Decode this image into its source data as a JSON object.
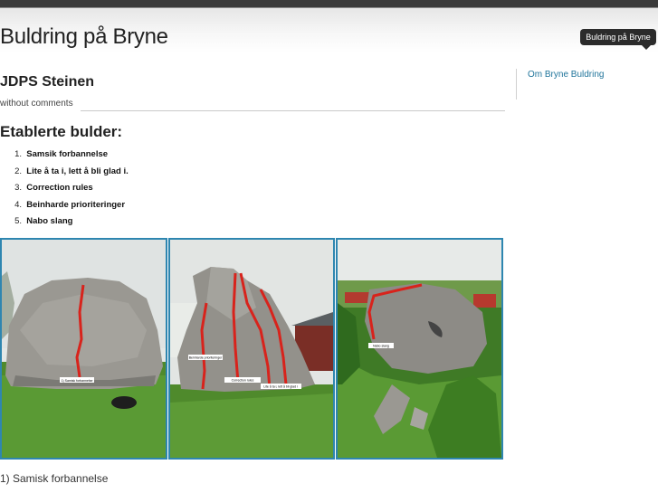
{
  "header": {
    "site_title": "Buldring på Bryne",
    "badge_label": "Buldring på Bryne"
  },
  "post": {
    "title": "JDPS Steinen",
    "meta": "without comments",
    "section_heading": "Etablerte bulder:",
    "bulder": [
      {
        "num": "1.",
        "label": "Samsik forbannelse"
      },
      {
        "num": "2.",
        "label": "Lite å ta i, lett å bli glad i."
      },
      {
        "num": "3.",
        "label": "Correction rules"
      },
      {
        "num": "4.",
        "label": "Beinharde prioriteringer"
      },
      {
        "num": "5.",
        "label": "Nabo slang"
      }
    ],
    "photos": [
      {
        "route_labels": [
          "1) Samisk forbannelse"
        ]
      },
      {
        "route_labels": [
          "Beinharde prioriteringer",
          "Correction rules",
          "Lite å ta i, lett å bli glad i"
        ]
      },
      {
        "route_labels": [
          "Nabo slang"
        ]
      }
    ],
    "caption": "1) Samisk forbannelse"
  },
  "sidebar": {
    "link_label": "Om Bryne Buldring"
  },
  "colors": {
    "link": "#21759b",
    "photo_border": "#2e86b0",
    "route_line": "#d8231c"
  }
}
